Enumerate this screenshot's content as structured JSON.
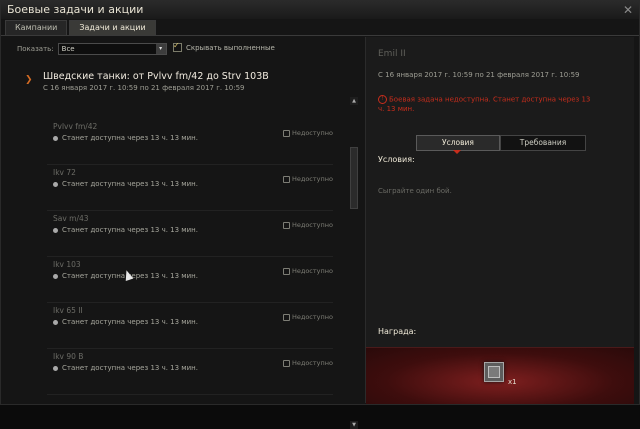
{
  "window": {
    "title": "Боевые задачи и акции",
    "close": "✕"
  },
  "tabs": [
    {
      "label": "Кампании"
    },
    {
      "label": "Задачи и акции"
    }
  ],
  "filter": {
    "label": "Показать:",
    "value": "Все",
    "arrow": "▾"
  },
  "hide_completed": {
    "label": "Скрывать выполненные"
  },
  "group": {
    "chevron": "❯",
    "title": "Шведские танки: от Pvlvv fm/42 до Strv 103B",
    "dates": "С 16 января 2017 г. 10:59 по 21 февраля 2017 г. 10:59"
  },
  "tasks": [
    {
      "name": "Pvlvv fm/42",
      "status": "Станет доступна через 13 ч. 13 мин.",
      "availability": "Недоступно"
    },
    {
      "name": "Ikv 72",
      "status": "Станет доступна через 13 ч. 13 мин.",
      "availability": "Недоступно"
    },
    {
      "name": "Sav m/43",
      "status": "Станет доступна через 13 ч. 13 мин.",
      "availability": "Недоступно"
    },
    {
      "name": "Ikv 103",
      "status": "Станет доступна через 13 ч. 13 мин.",
      "availability": "Недоступно"
    },
    {
      "name": "Ikv 65 II",
      "status": "Станет доступна через 13 ч. 13 мин.",
      "availability": "Недоступно"
    },
    {
      "name": "Ikv 90 B",
      "status": "Станет доступна через 13 ч. 13 мин.",
      "availability": "Недоступно"
    }
  ],
  "scrollbar": {
    "up": "▲",
    "down": "▼"
  },
  "detail": {
    "title": "Emil II",
    "dates": "С 16 января 2017 г. 10:59 по 21 февраля 2017 г. 10:59",
    "error_icon": "!",
    "error": "Боевая задача недоступна. Станет доступна через 13 ч. 13 мин.",
    "tabs": {
      "conditions": "Условия",
      "requirements": "Требования"
    },
    "conditions_label": "Условия:",
    "conditions_text": "Сыграйте один бой.",
    "reward_label": "Награда:",
    "reward_qty": "x1"
  },
  "colors": {
    "accent": "#d46b23",
    "error": "#c72d1c",
    "reward_bg": "#7f1f1f"
  }
}
